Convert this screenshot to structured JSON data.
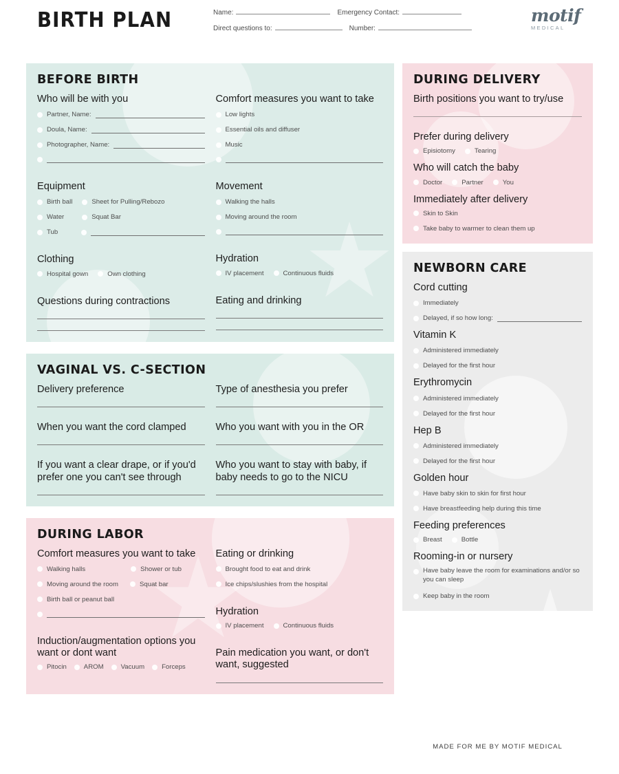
{
  "header": {
    "title": "BIRTH PLAN",
    "fields": [
      {
        "label": "Name:",
        "value": ""
      },
      {
        "label": "Emergency Contact:",
        "value": ""
      },
      {
        "label": "Direct questions to:",
        "value": ""
      },
      {
        "label": "Number:",
        "value": ""
      }
    ],
    "logo_word": "motif",
    "logo_sub": "MEDICAL"
  },
  "colors": {
    "mint": "#dcece8",
    "pink": "#f7dde2",
    "grey": "#ececec",
    "text": "#1d1d1d",
    "logo": "#5c6b76"
  },
  "before_birth": {
    "title": "BEFORE BIRTH",
    "who_heading": "Who will be with you",
    "who_items": [
      {
        "label": "Partner, Name:",
        "has_line": true
      },
      {
        "label": "Doula, Name:",
        "has_line": true
      },
      {
        "label": "Photographer, Name:",
        "has_line": true
      },
      {
        "label": "",
        "has_line": true
      }
    ],
    "comfort_heading": "Comfort measures you want to take",
    "comfort_items": [
      "Low lights",
      "Essential oils and diffuser",
      "Music"
    ],
    "equipment_heading": "Equipment",
    "equipment_rows": [
      [
        "Birth ball",
        "Sheet for Pulling/Rebozo"
      ],
      [
        "Water",
        "Squat Bar"
      ],
      [
        "Tub",
        ""
      ]
    ],
    "movement_heading": "Movement",
    "movement_items": [
      "Walking the halls",
      "Moving around the room"
    ],
    "clothing_heading": "Clothing",
    "clothing_items": [
      "Hospital gown",
      "Own clothing"
    ],
    "hydration_heading": "Hydration",
    "hydration_items": [
      "IV placement",
      "Continuous fluids"
    ],
    "questions_heading": "Questions during contractions",
    "eating_heading": "Eating and drinking"
  },
  "vaginal_csection": {
    "title": "VAGINAL VS. C-SECTION",
    "left_prompts": [
      "Delivery preference",
      "When you want the cord clamped",
      "If you want a clear drape, or if you'd prefer one you can't see through"
    ],
    "right_prompts": [
      "Type of anesthesia you prefer",
      "Who you want with you in the OR",
      "Who you want to stay with baby, if baby needs to go to the NICU"
    ]
  },
  "during_labor": {
    "title": "DURING LABOR",
    "comfort_heading": "Comfort measures you want to take",
    "comfort_rows": [
      [
        "Walking halls",
        "Shower or tub"
      ],
      [
        "Moving around the room",
        "Squat bar"
      ],
      [
        "Birth ball or peanut ball",
        ""
      ]
    ],
    "induction_heading": "Induction/augmentation options you want or dont want",
    "induction_items": [
      "Pitocin",
      "AROM",
      "Vacuum",
      "Forceps"
    ],
    "eating_heading": "Eating or drinking",
    "eating_items": [
      "Brought food to eat and drink",
      "Ice chips/slushies from the hospital"
    ],
    "hydration_heading": "Hydration",
    "hydration_items": [
      "IV placement",
      "Continuous fluids"
    ],
    "pain_heading": "Pain medication you want, or don't want, suggested"
  },
  "during_delivery": {
    "title": "DURING DELIVERY",
    "positions_heading": "Birth positions you want to try/use",
    "prefer_heading": "Prefer during delivery",
    "prefer_items": [
      "Episiotomy",
      "Tearing"
    ],
    "catch_heading": "Who will catch the baby",
    "catch_items": [
      "Doctor",
      "Partner",
      "You"
    ],
    "after_heading": "Immediately after delivery",
    "after_items": [
      "Skin to Skin",
      "Take baby to warmer to clean them up"
    ]
  },
  "newborn_care": {
    "title": "NEWBORN CARE",
    "groups": [
      {
        "heading": "Cord cutting",
        "items": [
          {
            "label": "Immediately",
            "has_line": false
          },
          {
            "label": "Delayed, if so how long:",
            "has_line": true
          }
        ]
      },
      {
        "heading": "Vitamin K",
        "items": [
          {
            "label": "Administered immediately",
            "has_line": false
          },
          {
            "label": "Delayed for the first hour",
            "has_line": false
          }
        ]
      },
      {
        "heading": "Erythromycin",
        "items": [
          {
            "label": "Administered immediately",
            "has_line": false
          },
          {
            "label": "Delayed for the first hour",
            "has_line": false
          }
        ]
      },
      {
        "heading": "Hep B",
        "items": [
          {
            "label": "Administered immediately",
            "has_line": false
          },
          {
            "label": "Delayed for the first hour",
            "has_line": false
          }
        ]
      },
      {
        "heading": "Golden hour",
        "items": [
          {
            "label": "Have baby skin to skin for first hour",
            "has_line": false
          },
          {
            "label": "Have breastfeeding help during this time",
            "has_line": false
          }
        ]
      },
      {
        "heading": "Feeding preferences",
        "inline": true,
        "items": [
          {
            "label": "Breast",
            "has_line": false
          },
          {
            "label": "Bottle",
            "has_line": false
          }
        ]
      },
      {
        "heading": "Rooming-in or nursery",
        "items": [
          {
            "label": "Have baby leave the room for examinations and/or so you can sleep",
            "has_line": false
          },
          {
            "label": "Keep baby in the room",
            "has_line": false
          }
        ]
      }
    ]
  },
  "footer": {
    "text": "MADE FOR ME BY MOTIF MEDICAL"
  }
}
